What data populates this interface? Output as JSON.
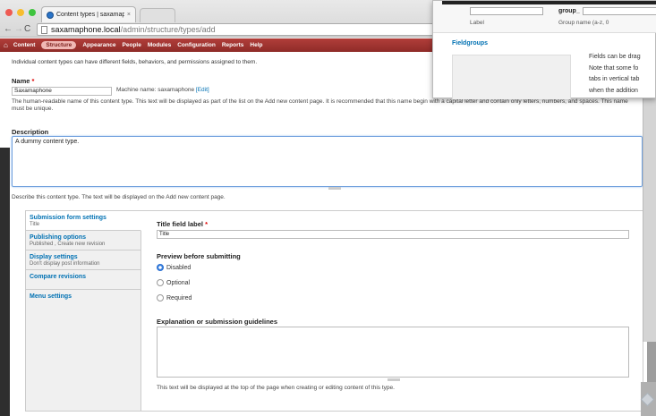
{
  "browser": {
    "tab_title": "Content types | saxamaph",
    "tab_close": "×",
    "url_host": "saxamaphone.local",
    "url_path": "/admin/structure/types/add"
  },
  "toolbar": {
    "home": "⌂",
    "items": [
      "Content",
      "Structure",
      "Appearance",
      "People",
      "Modules",
      "Configuration",
      "Reports",
      "Help"
    ]
  },
  "intro": "Individual content types can have different fields, behaviors, and permissions assigned to them.",
  "name": {
    "label": "Name",
    "required": "*",
    "value": "Saxamaphone",
    "machine_prefix": "Machine name: saxamaphone",
    "edit_link": "[Edit]",
    "help": "The human-readable name of this content type. This text will be displayed as part of the list on the Add new content page. It is recommended that this name begin with a capital letter and contain only letters, numbers, and spaces. This name must be unique."
  },
  "description": {
    "label": "Description",
    "value": "A dummy content type.",
    "help": "Describe this content type. The text will be displayed on the Add new content page."
  },
  "vertical_tabs": [
    {
      "title": "Submission form settings",
      "summary": "Title"
    },
    {
      "title": "Publishing options",
      "summary": "Published , Create new revision"
    },
    {
      "title": "Display settings",
      "summary": "Don't display post information"
    },
    {
      "title": "Compare revisions",
      "summary": ""
    },
    {
      "title": "Menu settings",
      "summary": ""
    }
  ],
  "submission": {
    "title_label": "Title field label",
    "required": "*",
    "title_value": "Title",
    "preview_label": "Preview before submitting",
    "options": [
      "Disabled",
      "Optional",
      "Required"
    ],
    "selected": "Disabled",
    "explanation_label": "Explanation or submission guidelines",
    "explanation_help": "This text will be displayed at the top of the page when creating or editing content of this type."
  },
  "overlay": {
    "label": "Label",
    "group_prefix": "group_",
    "group_name": "Group name (a-z, 0",
    "fieldgroups": "Fieldgroups",
    "text_lines": [
      "Fields can be drag",
      "Note that some fo",
      "tabs in vertical tab",
      "when the addition"
    ]
  }
}
